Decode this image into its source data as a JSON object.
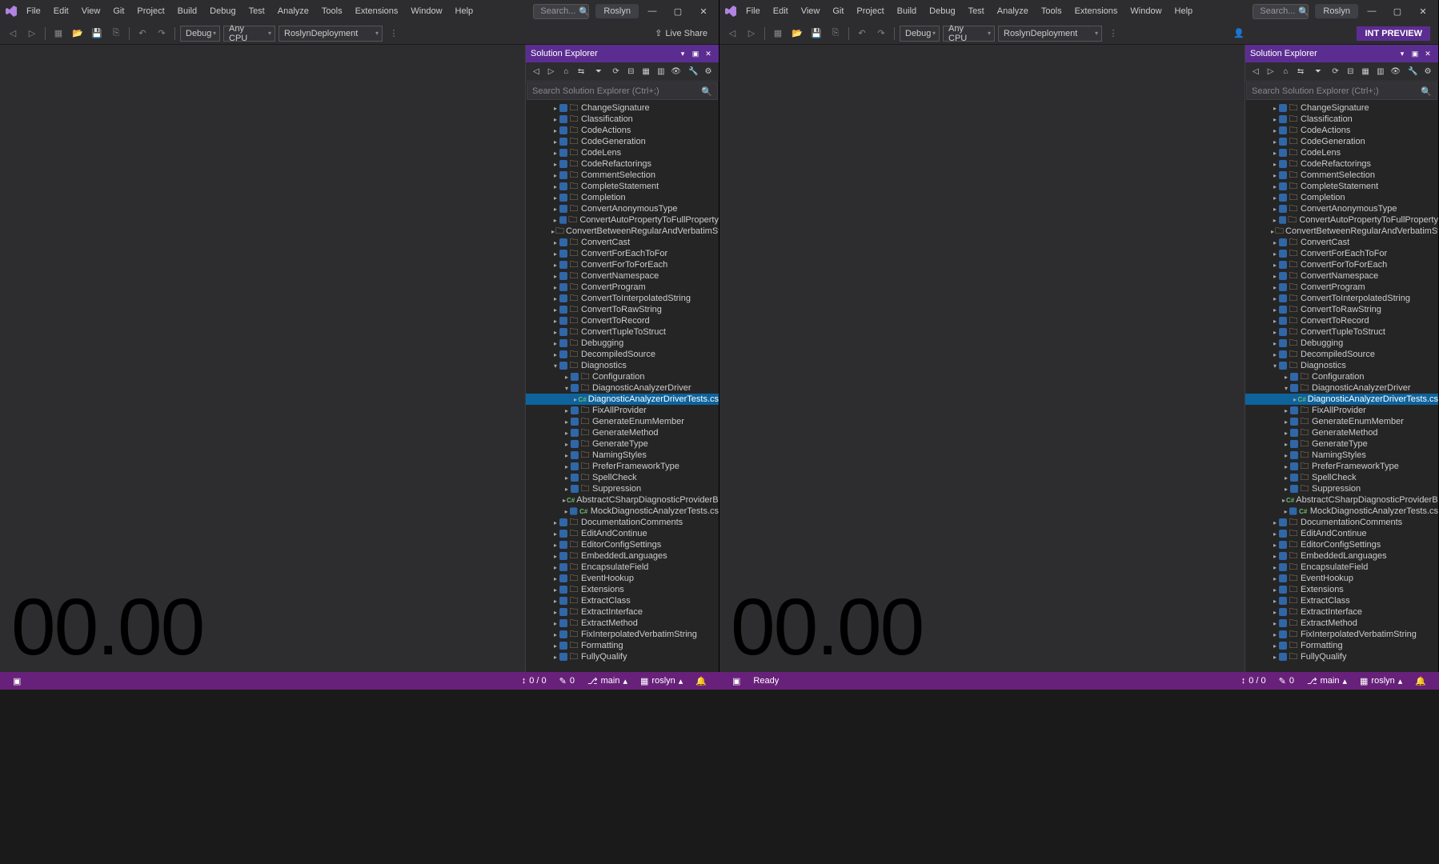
{
  "menus": [
    "File",
    "Edit",
    "View",
    "Git",
    "Project",
    "Build",
    "Debug",
    "Test",
    "Analyze",
    "Tools",
    "Extensions",
    "Window",
    "Help"
  ],
  "title_search": "Search...",
  "roslyn": "Roslyn",
  "toolbar": {
    "debug": "Debug",
    "cpu": "Any CPU",
    "deploy": "RoslynDeployment",
    "live_share": "Live Share",
    "preview": "INT PREVIEW"
  },
  "sol": {
    "title": "Solution Explorer",
    "search": "Search Solution Explorer (Ctrl+;)"
  },
  "tree": [
    {
      "t": "f",
      "d": 1,
      "n": "ChangeSignature"
    },
    {
      "t": "f",
      "d": 1,
      "n": "Classification"
    },
    {
      "t": "f",
      "d": 1,
      "n": "CodeActions"
    },
    {
      "t": "f",
      "d": 1,
      "n": "CodeGeneration"
    },
    {
      "t": "f",
      "d": 1,
      "n": "CodeLens"
    },
    {
      "t": "f",
      "d": 1,
      "n": "CodeRefactorings"
    },
    {
      "t": "f",
      "d": 1,
      "n": "CommentSelection"
    },
    {
      "t": "f",
      "d": 1,
      "n": "CompleteStatement"
    },
    {
      "t": "f",
      "d": 1,
      "n": "Completion"
    },
    {
      "t": "f",
      "d": 1,
      "n": "ConvertAnonymousType"
    },
    {
      "t": "f",
      "d": 1,
      "n": "ConvertAutoPropertyToFullProperty"
    },
    {
      "t": "f",
      "d": 1,
      "n": "ConvertBetweenRegularAndVerbatimString"
    },
    {
      "t": "f",
      "d": 1,
      "n": "ConvertCast"
    },
    {
      "t": "f",
      "d": 1,
      "n": "ConvertForEachToFor"
    },
    {
      "t": "f",
      "d": 1,
      "n": "ConvertForToForEach"
    },
    {
      "t": "f",
      "d": 1,
      "n": "ConvertNamespace"
    },
    {
      "t": "f",
      "d": 1,
      "n": "ConvertProgram"
    },
    {
      "t": "f",
      "d": 1,
      "n": "ConvertToInterpolatedString"
    },
    {
      "t": "f",
      "d": 1,
      "n": "ConvertToRawString"
    },
    {
      "t": "f",
      "d": 1,
      "n": "ConvertToRecord"
    },
    {
      "t": "f",
      "d": 1,
      "n": "ConvertTupleToStruct"
    },
    {
      "t": "f",
      "d": 1,
      "n": "Debugging"
    },
    {
      "t": "f",
      "d": 1,
      "n": "DecompiledSource"
    },
    {
      "t": "f",
      "d": 1,
      "n": "Diagnostics",
      "exp": true
    },
    {
      "t": "f",
      "d": 2,
      "n": "Configuration"
    },
    {
      "t": "f",
      "d": 2,
      "n": "DiagnosticAnalyzerDriver",
      "exp": true
    },
    {
      "t": "cs",
      "d": 3,
      "n": "DiagnosticAnalyzerDriverTests.cs",
      "sel": true
    },
    {
      "t": "f",
      "d": 2,
      "n": "FixAllProvider"
    },
    {
      "t": "f",
      "d": 2,
      "n": "GenerateEnumMember"
    },
    {
      "t": "f",
      "d": 2,
      "n": "GenerateMethod"
    },
    {
      "t": "f",
      "d": 2,
      "n": "GenerateType"
    },
    {
      "t": "f",
      "d": 2,
      "n": "NamingStyles"
    },
    {
      "t": "f",
      "d": 2,
      "n": "PreferFrameworkType"
    },
    {
      "t": "f",
      "d": 2,
      "n": "SpellCheck"
    },
    {
      "t": "f",
      "d": 2,
      "n": "Suppression"
    },
    {
      "t": "cs",
      "d": 2,
      "n": "AbstractCSharpDiagnosticProviderBasedUserDiagnosticTest.cs"
    },
    {
      "t": "cs",
      "d": 2,
      "n": "MockDiagnosticAnalyzerTests.cs"
    },
    {
      "t": "f",
      "d": 1,
      "n": "DocumentationComments"
    },
    {
      "t": "f",
      "d": 1,
      "n": "EditAndContinue"
    },
    {
      "t": "f",
      "d": 1,
      "n": "EditorConfigSettings"
    },
    {
      "t": "f",
      "d": 1,
      "n": "EmbeddedLanguages"
    },
    {
      "t": "f",
      "d": 1,
      "n": "EncapsulateField"
    },
    {
      "t": "f",
      "d": 1,
      "n": "EventHookup"
    },
    {
      "t": "f",
      "d": 1,
      "n": "Extensions"
    },
    {
      "t": "f",
      "d": 1,
      "n": "ExtractClass"
    },
    {
      "t": "f",
      "d": 1,
      "n": "ExtractInterface"
    },
    {
      "t": "f",
      "d": 1,
      "n": "ExtractMethod"
    },
    {
      "t": "f",
      "d": 1,
      "n": "FixInterpolatedVerbatimString"
    },
    {
      "t": "f",
      "d": 1,
      "n": "Formatting"
    },
    {
      "t": "f",
      "d": 1,
      "n": "FullyQualify"
    }
  ],
  "status": {
    "ready": "Ready",
    "nav": "0 / 0",
    "pen": "0",
    "branch": "main",
    "repo": "roslyn"
  },
  "timer": "00.00"
}
